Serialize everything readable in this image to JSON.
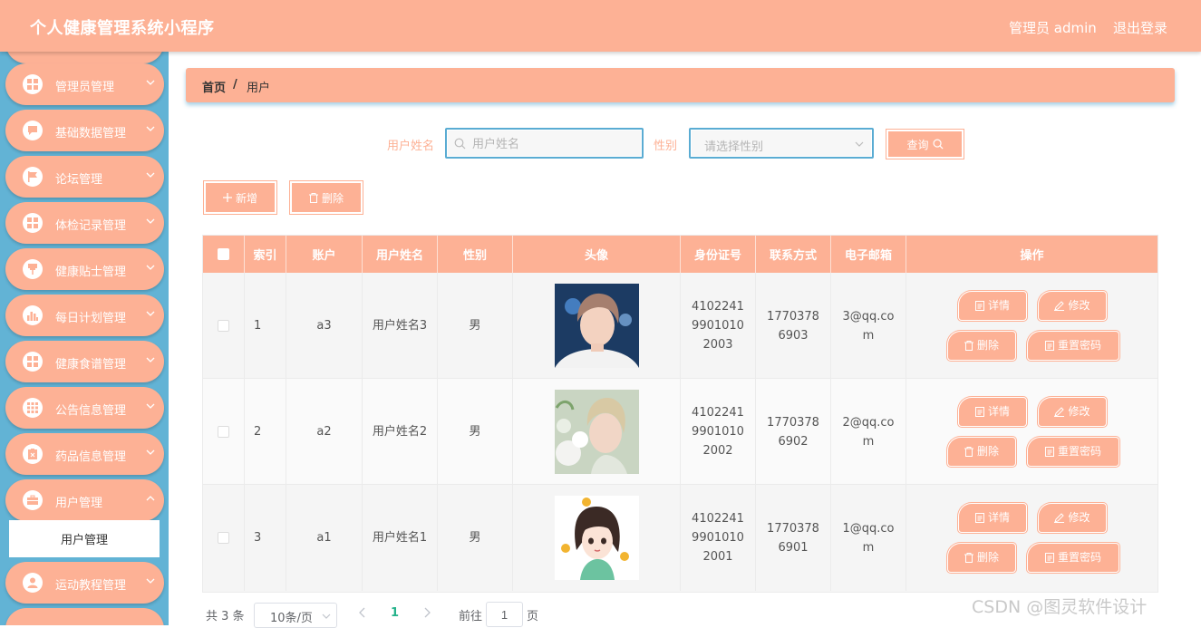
{
  "header": {
    "title": "个人健康管理系统小程序",
    "admin_label": "管理员 admin",
    "logout_label": "退出登录"
  },
  "sidebar": {
    "items": [
      {
        "label": "管理员管理",
        "icon": "grid-icon"
      },
      {
        "label": "基础数据管理",
        "icon": "chat-icon"
      },
      {
        "label": "论坛管理",
        "icon": "flag-icon"
      },
      {
        "label": "体检记录管理",
        "icon": "grid-icon"
      },
      {
        "label": "健康贴士管理",
        "icon": "pin-icon"
      },
      {
        "label": "每日计划管理",
        "icon": "bar-chart-icon"
      },
      {
        "label": "健康食谱管理",
        "icon": "grid-icon"
      },
      {
        "label": "公告信息管理",
        "icon": "apps-icon"
      },
      {
        "label": "药品信息管理",
        "icon": "clipboard-icon"
      },
      {
        "label": "用户管理",
        "icon": "briefcase-icon"
      },
      {
        "label": "运动教程管理",
        "icon": "user-icon"
      }
    ],
    "active_sub": "用户管理"
  },
  "breadcrumb": {
    "home": "首页",
    "separator": "/",
    "current": "用户"
  },
  "search": {
    "name_label": "用户姓名",
    "name_placeholder": "用户姓名",
    "gender_label": "性别",
    "gender_placeholder": "请选择性别",
    "query_label": "查询"
  },
  "actions": {
    "add_label": "新增",
    "delete_label": "删除"
  },
  "table": {
    "columns": [
      "索引",
      "账户",
      "用户姓名",
      "性别",
      "头像",
      "身份证号",
      "联系方式",
      "电子邮箱",
      "操作"
    ],
    "rows": [
      {
        "index": "1",
        "account": "a3",
        "name": "用户姓名3",
        "gender": "男",
        "id_card": "410224199010102003",
        "phone": "17703786903",
        "email": "3@qq.com"
      },
      {
        "index": "2",
        "account": "a2",
        "name": "用户姓名2",
        "gender": "男",
        "id_card": "410224199010102002",
        "phone": "17703786902",
        "email": "2@qq.com"
      },
      {
        "index": "3",
        "account": "a1",
        "name": "用户姓名1",
        "gender": "男",
        "id_card": "410224199010102001",
        "phone": "17703786901",
        "email": "1@qq.com"
      }
    ],
    "row_actions": {
      "detail": "详情",
      "edit": "修改",
      "delete": "删除",
      "reset": "重置密码"
    }
  },
  "pagination": {
    "total": "共 3 条",
    "page_size": "10条/页",
    "current_page": "1",
    "goto_label": "前往",
    "goto_value": "1",
    "page_suffix": "页"
  },
  "watermark": "CSDN @图灵软件设计",
  "colors": {
    "accent": "#fdb195",
    "sidebar_bg": "#62b3d5",
    "active_page": "#24b28a"
  }
}
